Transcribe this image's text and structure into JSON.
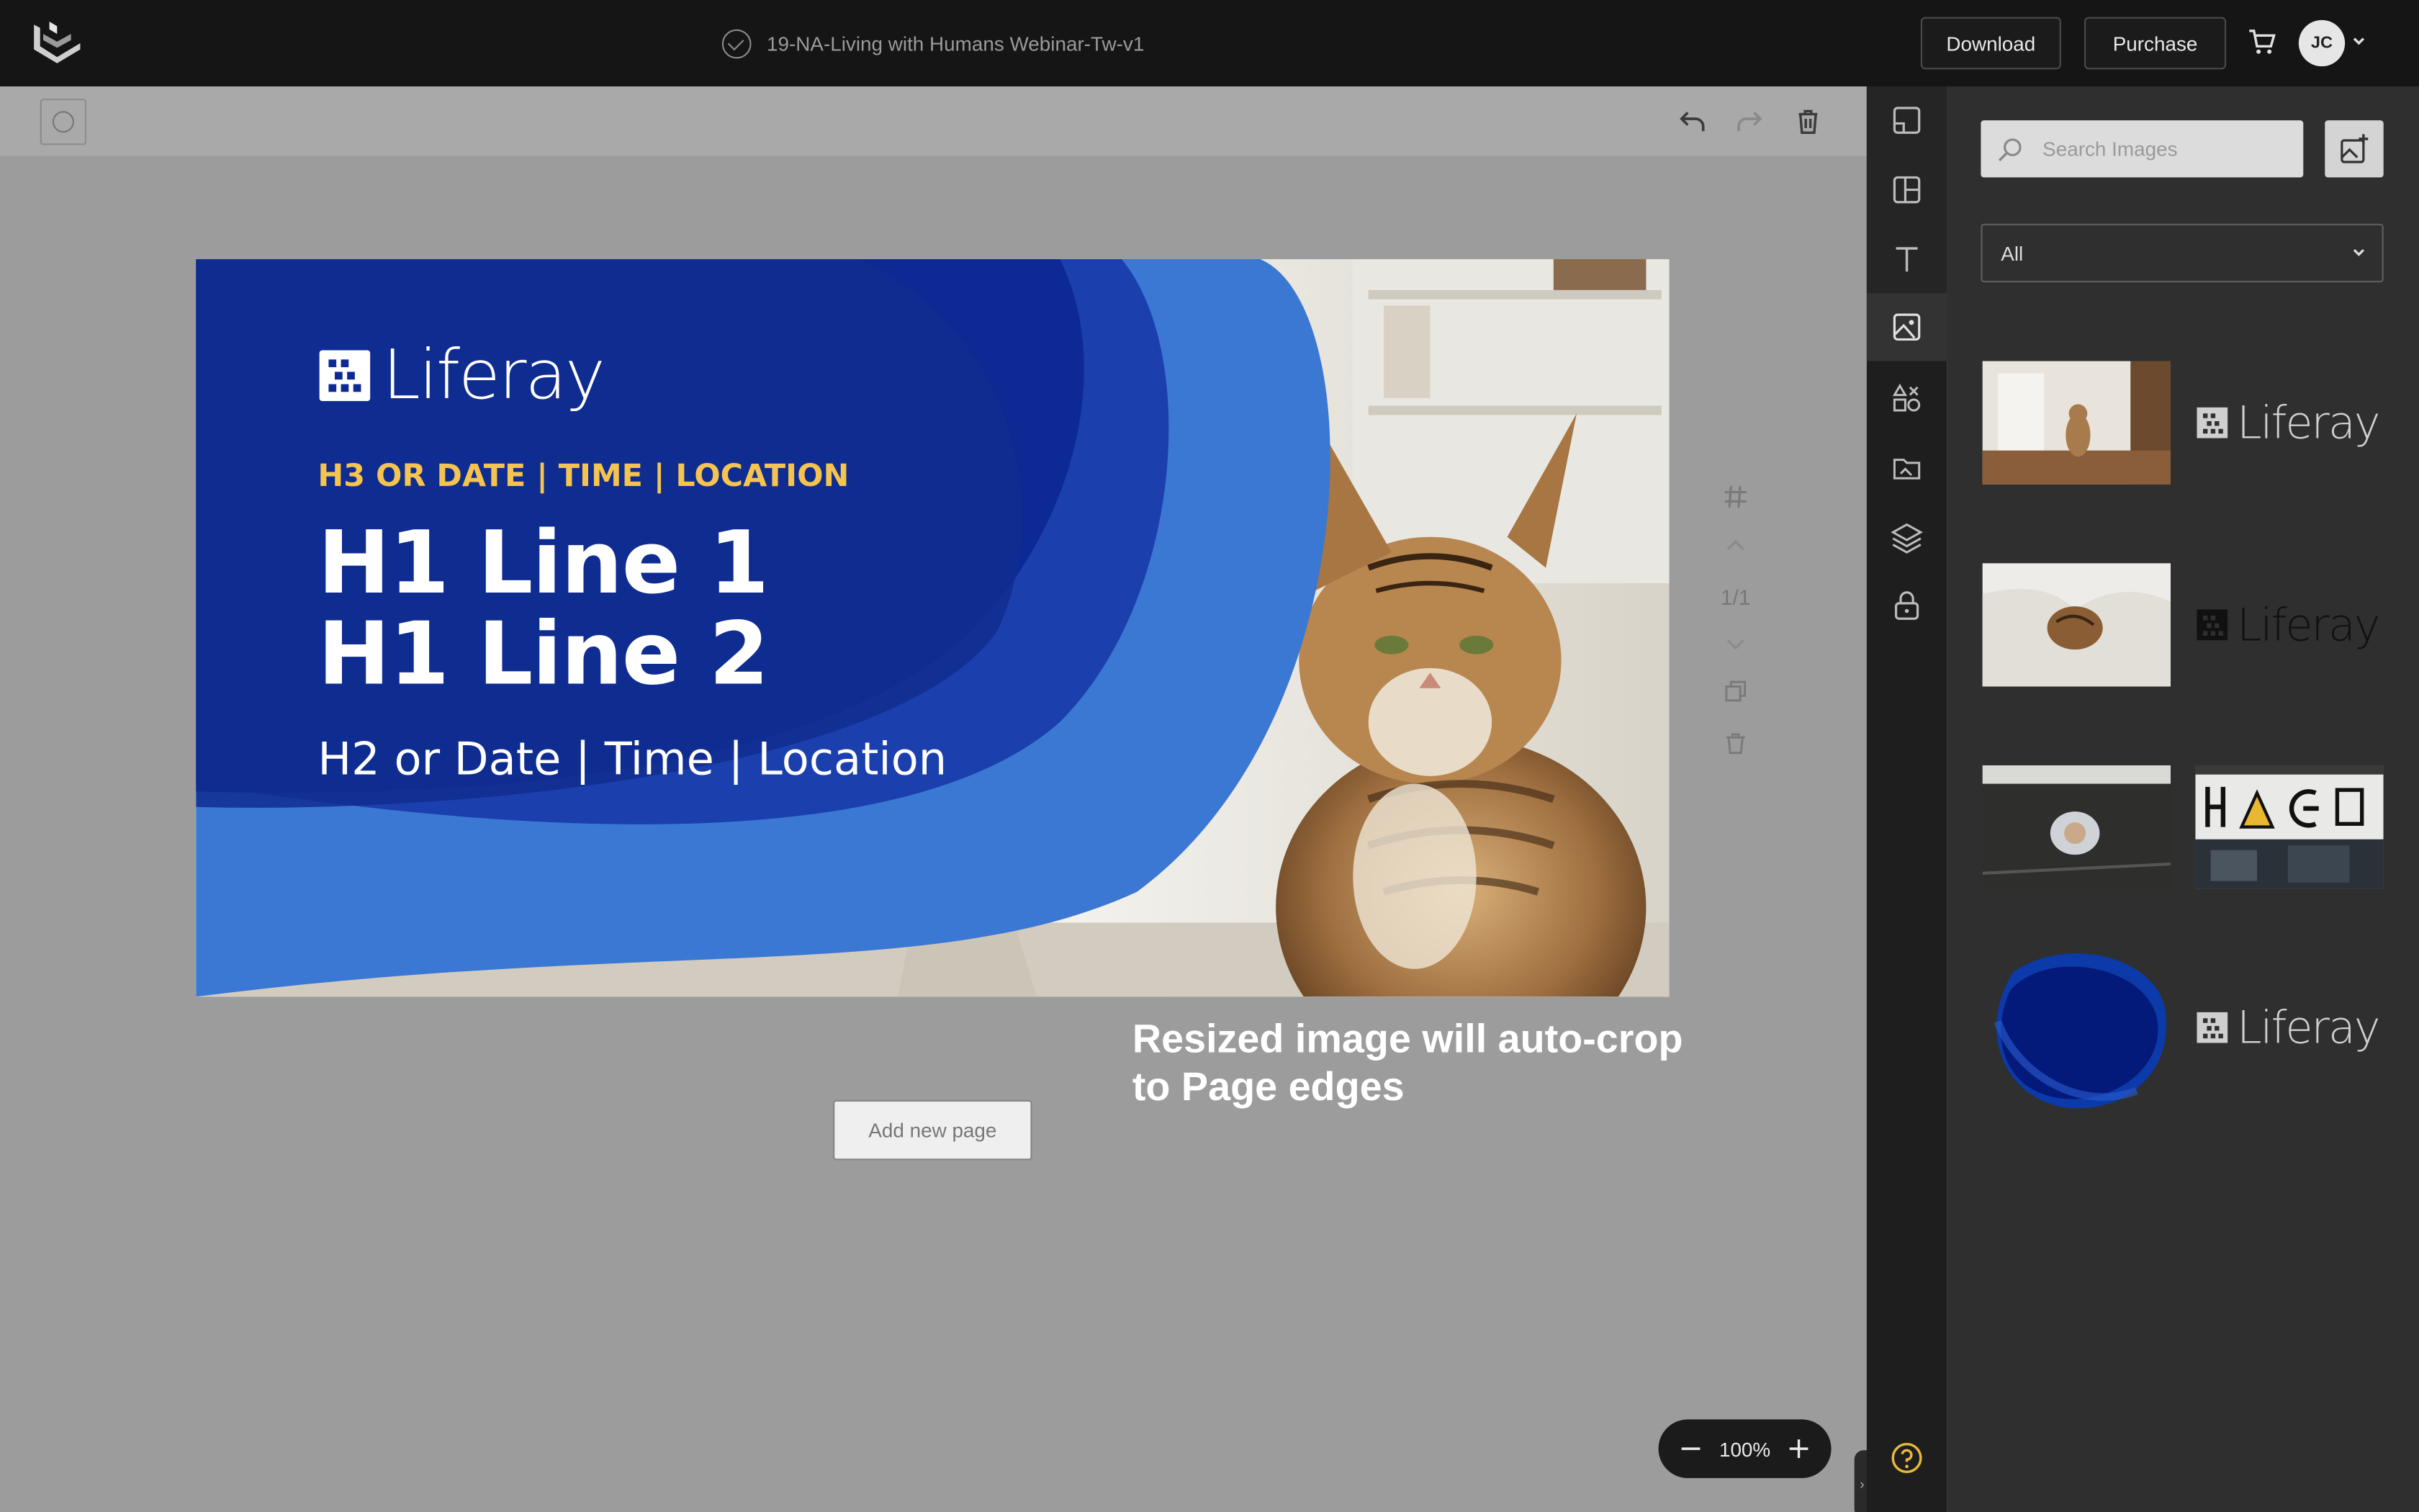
{
  "header": {
    "doc_title": "19-NA-Living with Humans Webinar-Tw-v1",
    "download_label": "Download",
    "purchase_label": "Purchase",
    "avatar_initials": "JC"
  },
  "banner": {
    "logo_text": "Liferay",
    "h3_text": "H3 OR DATE | TIME | LOCATION",
    "h1_line1": "H1 Line 1",
    "h1_line2": "H1 Line 2",
    "h2_text": "H2 or Date | Time | Location"
  },
  "page_controls": {
    "page_indicator": "1/1"
  },
  "crop_note": {
    "line1": "Resized image will auto-crop",
    "line2": "to Page edges"
  },
  "add_page_label": "Add new page",
  "zoom": {
    "level": "100%"
  },
  "panel": {
    "search_placeholder": "Search Images",
    "filter_value": "All",
    "thumbnails": [
      {
        "name": "kitchen-cat-photo",
        "kind": "photo"
      },
      {
        "name": "liferay-logo-white",
        "kind": "logo",
        "text": "Liferay"
      },
      {
        "name": "sleeping-cat-photo",
        "kind": "photo"
      },
      {
        "name": "liferay-logo-dark",
        "kind": "logo",
        "text": "Liferay"
      },
      {
        "name": "overhead-person-photo",
        "kind": "photo"
      },
      {
        "name": "icons-wall-photo",
        "kind": "photo"
      },
      {
        "name": "blue-blob-shape",
        "kind": "shape"
      },
      {
        "name": "liferay-logo-white-2",
        "kind": "logo",
        "text": "Liferay"
      }
    ]
  },
  "colors": {
    "brand_blue": "#0b2d94",
    "accent_yellow": "#f5c450",
    "topbar": "#151515",
    "canvas_bg": "#9c9c9c",
    "panel_bg": "#2f2f2f"
  }
}
